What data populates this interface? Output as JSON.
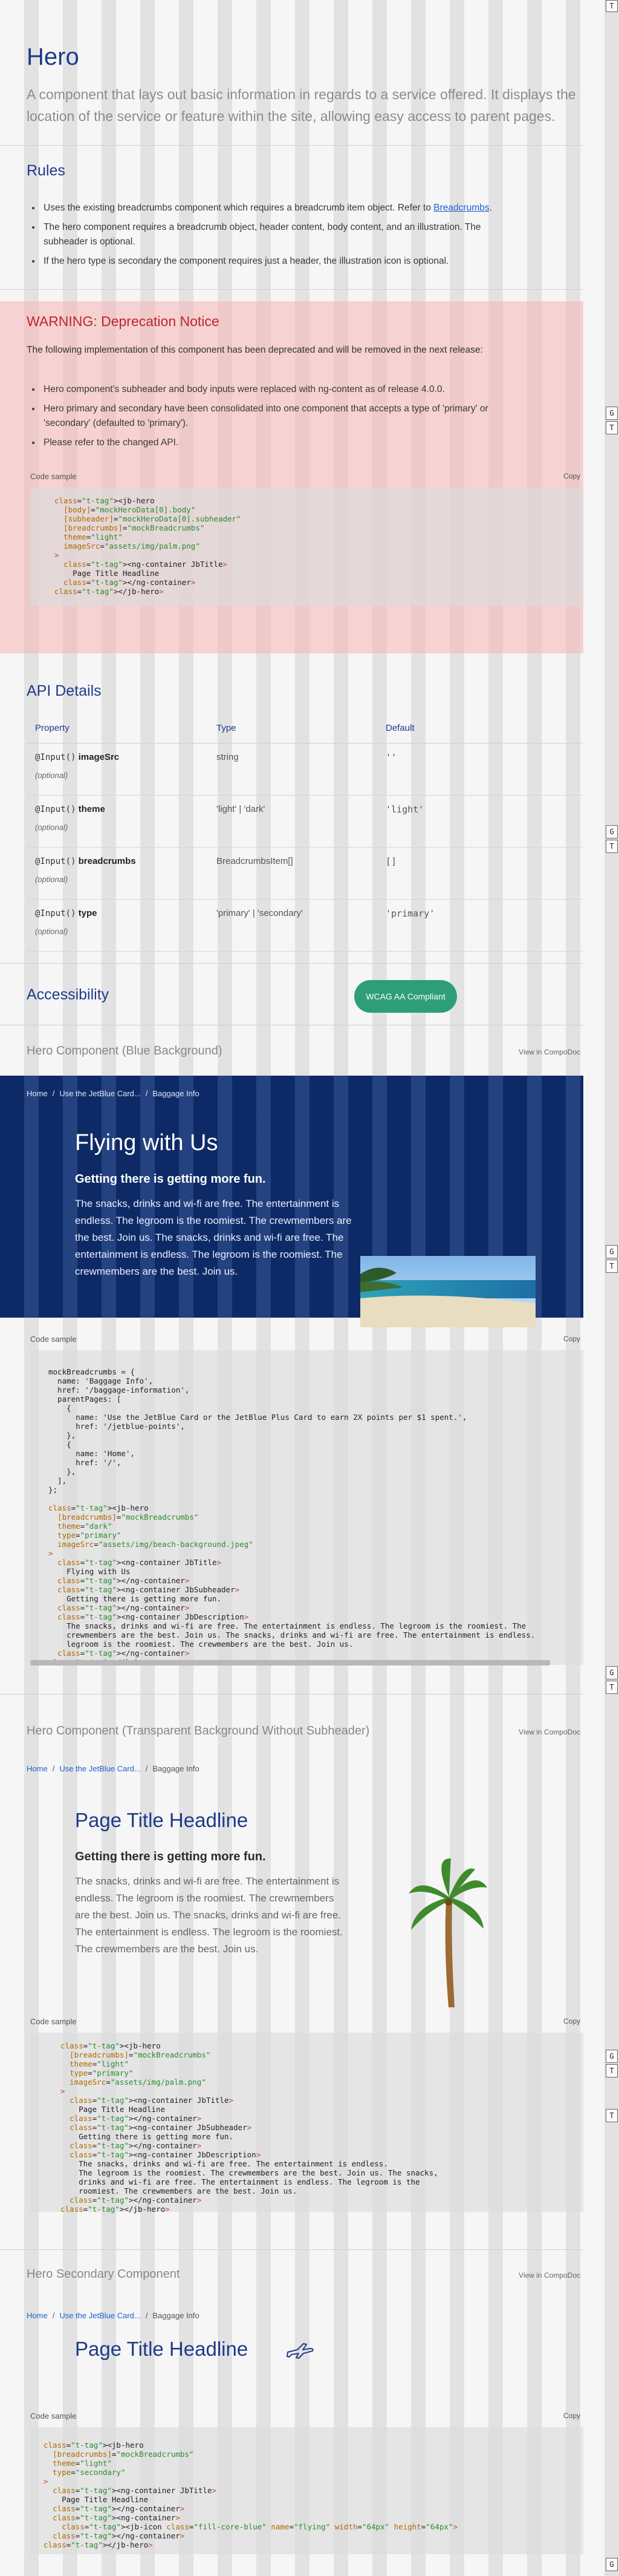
{
  "page": {
    "title": "Hero",
    "intro": "A component that lays out basic information in regards to a service offered. It displays the location of the service or feature within the site, allowing easy access to parent pages."
  },
  "rules": {
    "heading": "Rules",
    "items": [
      "Uses the existing breadcrumbs component which requires a breadcrumb item object. Refer to",
      "The hero component requires a breadcrumb object, header content, body content, and an illustration. The subheader is optional.",
      "If the hero type is secondary the component requires just a header, the illustration icon is optional."
    ],
    "link_text": "Breadcrumbs",
    "link_suffix": "."
  },
  "warning": {
    "title": "WARNING: Deprecation Notice",
    "text": "The following implementation of this component has been deprecated and will be removed in the next release:",
    "items": [
      "Hero component's subheader and body inputs were replaced with ng-content as of release 4.0.0.",
      "Hero primary and secondary have been consolidated into one component that accepts a type of 'primary' or 'secondary' (defaulted to 'primary').",
      "Please refer to the changed API."
    ],
    "code_label": "Code sample",
    "copy_label": "Copy",
    "code": [
      "<jb-hero",
      "  [body]=\"mockHeroData[0].body\"",
      "  [subheader]=\"mockHeroData[0].subheader\"",
      "  [breadcrumbs]=\"mockBreadcrumbs\"",
      "  theme=\"light\"",
      "  imageSrc=\"assets/img/palm.png\"",
      ">",
      "  <ng-container JbTitle>",
      "    Page Title Headline",
      "  </ng-container>",
      "</jb-hero>"
    ]
  },
  "api": {
    "heading": "API Details",
    "columns": [
      "Property",
      "Type",
      "Default"
    ],
    "rows": [
      {
        "decorator": "@Input()",
        "name": "imageSrc",
        "optional": "(optional)",
        "type": "string",
        "default": "''"
      },
      {
        "decorator": "@Input()",
        "name": "theme",
        "optional": "(optional)",
        "type": "'light' | 'dark'",
        "default": "'light'"
      },
      {
        "decorator": "@Input()",
        "name": "breadcrumbs",
        "optional": "(optional)",
        "type": "BreadcrumbsItem[]",
        "default": "[]"
      },
      {
        "decorator": "@Input()",
        "name": "type",
        "optional": "(optional)",
        "type": "'primary' | 'secondary'",
        "default": "'primary'"
      }
    ]
  },
  "accessibility": {
    "heading": "Accessibility",
    "badge": "WCAG AA Compliant"
  },
  "demo_blue": {
    "title": "Hero Component (Blue Background)",
    "view_link": "View in CompoDoc",
    "breadcrumbs": [
      "Home",
      "Use the JetBlue Card...",
      "Baggage Info"
    ],
    "separator": "/",
    "headline": "Flying with Us",
    "subheader": "Getting there is getting more fun.",
    "body": "The snacks, drinks and wi-fi are free. The entertainment is endless. The legroom is the roomiest. The crewmembers are the best. Join us. The snacks, drinks and wi-fi are free. The entertainment is endless. The legroom is the roomiest. The crewmembers are the best. Join us.",
    "code_label": "Code sample",
    "copy_label": "Copy",
    "code": [
      "mockBreadcrumbs = {",
      "  name: 'Baggage Info',",
      "  href: '/baggage-information',",
      "  parentPages: [",
      "    {",
      "      name: 'Use the JetBlue Card or the JetBlue Plus Card to earn 2X points per $1 spent.',",
      "      href: '/jetblue-points',",
      "    },",
      "    {",
      "      name: 'Home',",
      "      href: '/',",
      "    },",
      "  ],",
      "};",
      "",
      "<jb-hero",
      "  [breadcrumbs]=\"mockBreadcrumbs\"",
      "  theme=\"dark\"",
      "  type=\"primary\"",
      "  imageSrc=\"assets/img/beach-background.jpeg\"",
      ">",
      "  <ng-container JbTitle>",
      "    Flying with Us",
      "  </ng-container>",
      "  <ng-container JbSubheader>",
      "    Getting there is getting more fun.",
      "  </ng-container>",
      "  <ng-container JbDescription>",
      "    The snacks, drinks and wi-fi are free. The entertainment is endless. The legroom is the roomiest. The",
      "    crewmembers are the best. Join us. The snacks, drinks and wi-fi are free. The entertainment is endless.",
      "    legroom is the roomiest. The crewmembers are the best. Join us.",
      "  </ng-container>",
      "</jb-hero>"
    ]
  },
  "demo_transparent": {
    "title": "Hero Component (Transparent Background Without Subheader)",
    "view_link": "View in CompoDoc",
    "breadcrumbs": [
      "Home",
      "Use the JetBlue Card...",
      "Baggage Info"
    ],
    "headline": "Page Title Headline",
    "subheader": "Getting there is getting more fun.",
    "body": "The snacks, drinks and wi-fi are free. The entertainment is endless. The legroom is the roomiest. The crewmembers are the best. Join us. The snacks, drinks and wi-fi are free. The entertainment is endless. The legroom is the roomiest. The crewmembers are the best. Join us.",
    "code_label": "Code sample",
    "copy_label": "Copy",
    "code": [
      "<jb-hero",
      "  [breadcrumbs]=\"mockBreadcrumbs\"",
      "  theme=\"light\"",
      "  type=\"primary\"",
      "  imageSrc=\"assets/img/palm.png\"",
      ">",
      "  <ng-container JbTitle>",
      "    Page Title Headline",
      "  </ng-container>",
      "  <ng-container JbSubheader>",
      "    Getting there is getting more fun.",
      "  </ng-container>",
      "  <ng-container JbDescription>",
      "    The snacks, drinks and wi-fi are free. The entertainment is endless.",
      "    The legroom is the roomiest. The crewmembers are the best. Join us. The snacks,",
      "    drinks and wi-fi are free. The entertainment is endless. The legroom is the",
      "    roomiest. The crewmembers are the best. Join us.",
      "  </ng-container>",
      "</jb-hero>"
    ]
  },
  "demo_secondary": {
    "title": "Hero Secondary Component",
    "view_link": "View in CompoDoc",
    "breadcrumbs": [
      "Home",
      "Use the JetBlue Card...",
      "Baggage Info"
    ],
    "headline": "Page Title Headline",
    "code_label": "Code sample",
    "copy_label": "Copy",
    "code": [
      "<jb-hero",
      "  [breadcrumbs]=\"mockBreadcrumbs\"",
      "  theme=\"light\"",
      "  type=\"secondary\"",
      ">",
      "  <ng-container JbTitle>",
      "    Page Title Headline",
      "  </ng-container>",
      "  <ng-container>",
      "    <jb-icon class=\"fill-core-blue\" name=\"flying\" width=\"64px\" height=\"64px\">",
      "  </ng-container>",
      "</jb-hero>"
    ]
  },
  "side_buttons": {
    "g": "G",
    "t": "T"
  },
  "colors": {
    "accent": "#1f3a8a",
    "hero_blue": "#0e2a66",
    "warning": "#c0262b",
    "wcag": "#2e9e78"
  },
  "icons": [
    "toolbar-toggle-icon",
    "flying-plane-icon",
    "beach-image",
    "palm-tree-image"
  ]
}
